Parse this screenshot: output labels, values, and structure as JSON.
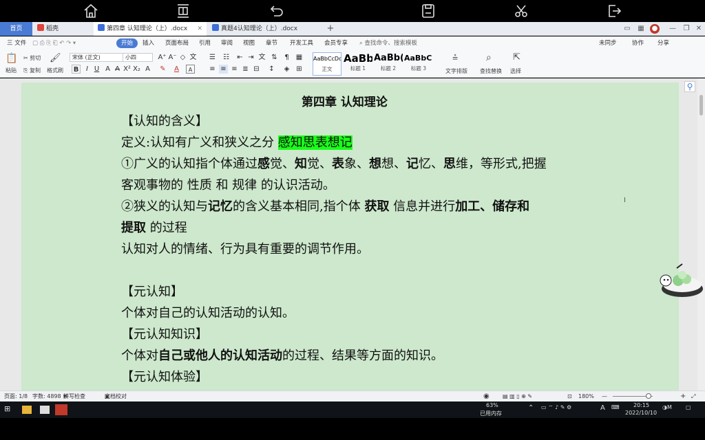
{
  "tablet_toolbar": {
    "icons": [
      "home-icon",
      "toolbar-toggle-icon",
      "undo-icon",
      "save-icon",
      "cut-icon",
      "exit-icon"
    ]
  },
  "tabs": {
    "home": "首页",
    "t1": "稻壳",
    "t2": "第四章 认知理论（上）.docx",
    "t3": "真题4认知理论（上）.docx"
  },
  "menu": {
    "file": "三 文件",
    "items": [
      "开始",
      "插入",
      "页面布局",
      "引用",
      "审阅",
      "视图",
      "章节",
      "开发工具",
      "会员专享"
    ],
    "search": "查找命令、搜索模板",
    "right": [
      "未同步",
      "协作",
      "分享"
    ]
  },
  "ribbon": {
    "paste": "粘贴",
    "cut": "剪切",
    "copy": "复制",
    "format_painter": "格式刷",
    "font_name": "宋体 (正文)",
    "font_size": "小四",
    "styles": [
      {
        "sample": "AaBbCcDd",
        "label": "正文"
      },
      {
        "sample": "AaBb",
        "label": "标题 1"
      },
      {
        "sample": "AaBb(",
        "label": "标题 2"
      },
      {
        "sample": "AaBbC",
        "label": "标题 3"
      }
    ],
    "text_layout": "文字排版",
    "find_replace": "查找替换",
    "select": "选择"
  },
  "document": {
    "title": "第四章  认知理论",
    "lines": [
      {
        "segments": [
          {
            "t": "【认知的含义】"
          }
        ]
      },
      {
        "segments": [
          {
            "t": "定义:认知有广义和狭义之分    "
          },
          {
            "t": "感知思表想记",
            "hl": true
          }
        ]
      },
      {
        "segments": [
          {
            "t": "①广义的认知指个体通过"
          },
          {
            "t": "感",
            "b": true
          },
          {
            "t": "觉、"
          },
          {
            "t": "知",
            "b": true
          },
          {
            "t": "觉、"
          },
          {
            "t": "表",
            "b": true
          },
          {
            "t": "象、"
          },
          {
            "t": "想",
            "b": true
          },
          {
            "t": "想、"
          },
          {
            "t": "记",
            "b": true
          },
          {
            "t": "忆、"
          },
          {
            "t": "思",
            "b": true
          },
          {
            "t": "维，等形式,把握"
          }
        ]
      },
      {
        "segments": [
          {
            "t": "客观事物的  性质  和  规律                   的认识活动。"
          }
        ]
      },
      {
        "segments": [
          {
            "t": "②狭义的认知与"
          },
          {
            "t": "记忆",
            "b": true
          },
          {
            "t": "的含义基本相同,指个体  "
          },
          {
            "t": "获取",
            "b": true
          },
          {
            "t": "    信息并进行"
          },
          {
            "t": "加工、储存和",
            "b": true
          }
        ]
      },
      {
        "segments": [
          {
            "t": "提取",
            "b": true
          },
          {
            "t": "    的过程"
          }
        ]
      },
      {
        "segments": [
          {
            "t": "认知对人的情绪、行为具有重要的调节作用。"
          }
        ]
      },
      {
        "segments": [
          {
            "t": ""
          }
        ]
      },
      {
        "segments": [
          {
            "t": "【元认知】"
          }
        ]
      },
      {
        "segments": [
          {
            "t": "个体对自己的认知活动的认知。"
          }
        ]
      },
      {
        "segments": [
          {
            "t": "【元认知知识】"
          }
        ]
      },
      {
        "segments": [
          {
            "t": "个体对"
          },
          {
            "t": "自己或他人的认知活动",
            "b": true
          },
          {
            "t": "的过程、结果等方面的知识。"
          }
        ]
      },
      {
        "segments": [
          {
            "t": "【元认知体验】"
          }
        ]
      }
    ]
  },
  "status": {
    "page": "页面: 1/8",
    "words": "字数: 4898",
    "spell": "拼写检查",
    "proof": "文档校对",
    "zoom": "180%"
  },
  "taskbar": {
    "memory_pct": "63%",
    "memory_label": "已用内存",
    "time": "20:15",
    "date": "2022/10/10",
    "lang": "A"
  },
  "colors": {
    "accent": "#4a7bd4",
    "page_bg": "#cde8cc",
    "highlight": "#19ff19"
  }
}
